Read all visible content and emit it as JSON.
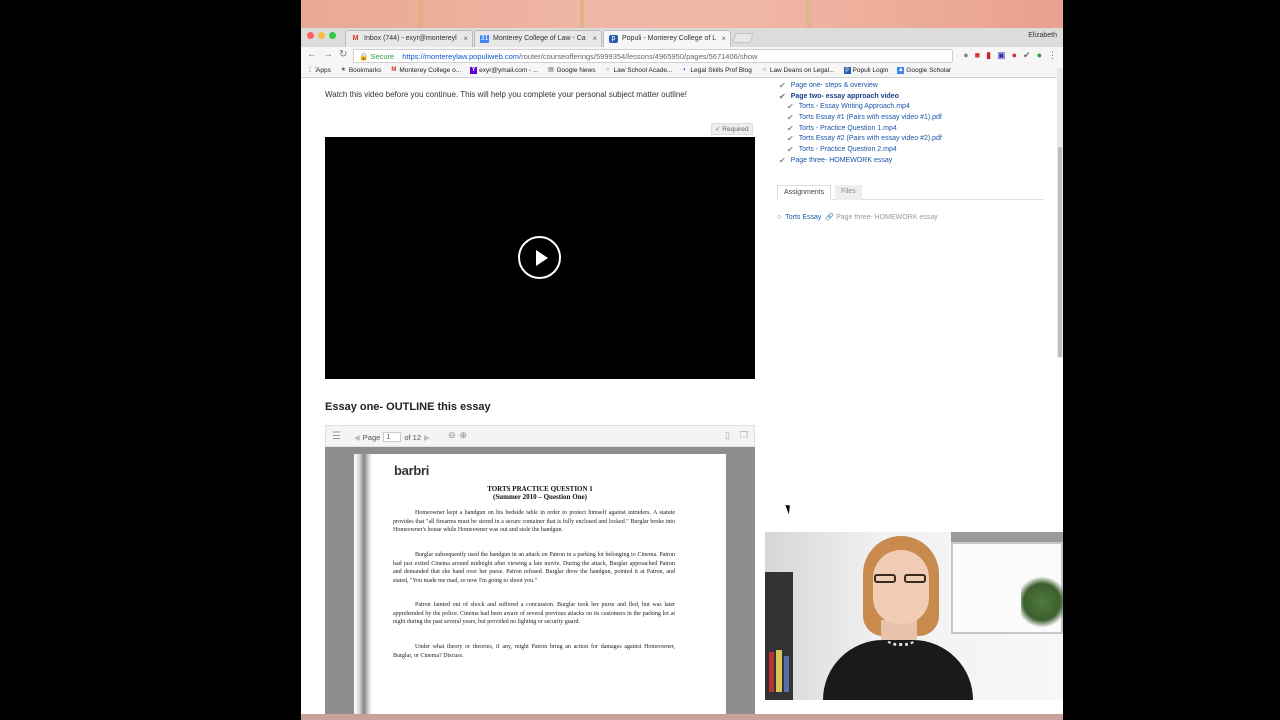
{
  "browser": {
    "tabs": [
      {
        "label": "Inbox (744) - exyr@montereyl",
        "icon": "gmail-icon"
      },
      {
        "label": "Monterey College of Law - Ca",
        "icon": "calendar-icon"
      },
      {
        "label": "Populi - Monterey College of L",
        "icon": "populi-icon"
      }
    ],
    "profile_name": "Elizabeth",
    "address": {
      "secure_label": "Secure",
      "url_host": "https://montereylaw.populiweb.com",
      "url_path": "/router/courseofferings/5999354/lessons/4965950/pages/5671406/show"
    },
    "bookmarks": [
      {
        "label": "Apps",
        "icon": "apps-grid-icon"
      },
      {
        "label": "Bookmarks",
        "icon": "star-icon"
      },
      {
        "label": "Monterey College o...",
        "icon": "gmail-icon"
      },
      {
        "label": "exyr@ymail.com - ...",
        "icon": "yahoo-icon"
      },
      {
        "label": "Google News",
        "icon": "news-icon"
      },
      {
        "label": "Law School Acade...",
        "icon": "globe-icon"
      },
      {
        "label": "Legal Skills Prof Blog",
        "icon": "blog-icon"
      },
      {
        "label": "Law Deans on Legal...",
        "icon": "globe-icon"
      },
      {
        "label": "Populi Login",
        "icon": "populi-icon"
      },
      {
        "label": "Google Scholar",
        "icon": "scholar-icon"
      }
    ]
  },
  "page": {
    "intro_text": "Watch this video before you continue. This will help you complete your personal subject matter outline!",
    "required_label": "Required",
    "essay_heading": "Essay one- OUTLINE this essay",
    "pdf_viewer": {
      "page_label": "Page",
      "page_value": "1",
      "page_total": "of 12"
    },
    "document": {
      "logo": "barbri",
      "title": "TORTS PRACTICE QUESTION 1",
      "subtitle": "(Summer 2010 – Question One)",
      "paragraphs": [
        "Homeowner kept a handgun on his bedside table in order to protect himself against intruders. A statute provides that \"all firearms must be stored in a secure container that is fully enclosed and locked.\" Burglar broke into Homeowner's house while Homeowner was out and stole the handgun.",
        "Burglar subsequently used the handgun in an attack on Patron in a parking lot belonging to Cinema. Patron had just exited Cinema around midnight after viewing a late movie. During the attack, Burglar approached Patron and demanded that she hand over her purse. Patron refused. Burglar drew the handgun, pointed it at Patron, and stated, \"You made me mad, so now I'm going to shoot you.\"",
        "Patron fainted out of shock and suffered a concussion. Burglar took her purse and fled, but was later apprehended by the police. Cinema had been aware of several previous attacks on its customers in the parking lot at night during the past several years, but provided no lighting or security guard.",
        "Under what theory or theories, if any, might Patron bring an action for damages against Homeowner, Burglar, or Cinema? Discuss."
      ]
    }
  },
  "sidebar": {
    "lessons": [
      {
        "label": "Page one- steps & overview",
        "bold": false,
        "indent": false
      },
      {
        "label": "Page two- essay approach video",
        "bold": true,
        "indent": false
      },
      {
        "label": "Torts - Essay Writing Approach.mp4",
        "bold": false,
        "indent": true
      },
      {
        "label": "Torts Essay #1 (Pairs with essay video #1).pdf",
        "bold": false,
        "indent": true
      },
      {
        "label": "Torts - Practice Question 1.mp4",
        "bold": false,
        "indent": true
      },
      {
        "label": "Torts Essay #2 (Pairs with essay video #2).pdf",
        "bold": false,
        "indent": true
      },
      {
        "label": "Torts - Practice Question 2.mp4",
        "bold": false,
        "indent": true
      },
      {
        "label": "Page three- HOMEWORK essay",
        "bold": false,
        "indent": false
      }
    ],
    "tabs": [
      "Assignments",
      "Files"
    ],
    "assignment": {
      "link": "Torts Essay",
      "meta": "Page three- HOMEWORK essay"
    }
  }
}
